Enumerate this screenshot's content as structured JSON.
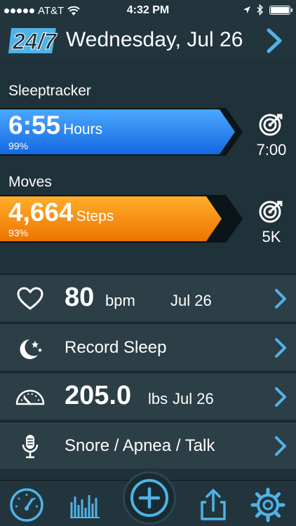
{
  "status_bar": {
    "carrier": "AT&T",
    "time": "4:32 PM"
  },
  "header": {
    "logo_text": "24/7",
    "date": "Wednesday, Jul 26",
    "next_icon": "chevron-right-icon"
  },
  "sleeptracker": {
    "label": "Sleeptracker",
    "value": "6:55",
    "unit": "Hours",
    "percent_text": "99%",
    "progress": 0.99,
    "goal": "7:00",
    "color": "#1e88f5"
  },
  "moves": {
    "label": "Moves",
    "value": "4,664",
    "unit": "Steps",
    "percent_text": "93%",
    "progress": 0.93,
    "goal": "5K",
    "color": "#f5910f"
  },
  "rows": [
    {
      "icon": "heart-icon",
      "value": "80",
      "unit": "bpm",
      "date": "Jul 26"
    },
    {
      "icon": "moon-stars-icon",
      "label": "Record Sleep"
    },
    {
      "icon": "scale-gauge-icon",
      "value": "205.0",
      "unit": "lbs",
      "date": "Jul 26"
    },
    {
      "icon": "microphone-icon",
      "label": "Snore / Apnea / Talk"
    }
  ],
  "tabbar": {
    "items": [
      "speedometer-icon",
      "bar-chart-icon",
      "add-icon",
      "share-icon",
      "settings-icon"
    ]
  },
  "colors": {
    "accent_blue": "#4fb3e8",
    "background": "#1f3139"
  }
}
